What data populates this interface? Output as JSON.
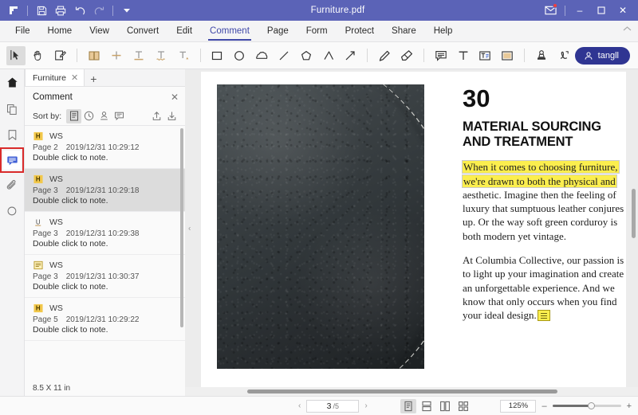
{
  "titlebar": {
    "document_title": "Furniture.pdf",
    "logo_icon": "app-logo-icon",
    "save_icon": "save-icon",
    "print_icon": "print-icon",
    "undo_icon": "undo-icon",
    "redo_icon": "redo-icon",
    "customize_icon": "chevron-down-icon",
    "mail_icon": "mail-icon",
    "minimize_label": "–",
    "maximize_label": "☐",
    "close_label": "✕",
    "accent_color": "#5b63b7",
    "notification_color": "#f03e3e"
  },
  "menubar": {
    "items": [
      {
        "label": "File"
      },
      {
        "label": "Home"
      },
      {
        "label": "View"
      },
      {
        "label": "Convert"
      },
      {
        "label": "Edit"
      },
      {
        "label": "Comment"
      },
      {
        "label": "Page"
      },
      {
        "label": "Form"
      },
      {
        "label": "Protect"
      },
      {
        "label": "Share"
      },
      {
        "label": "Help"
      }
    ],
    "active": "Comment",
    "collapse_icon": "chevron-up-icon",
    "active_color": "#3f48a8"
  },
  "ribbon": {
    "tools": [
      {
        "name": "select-tool",
        "icon": "cursor-select-icon",
        "selected": true
      },
      {
        "name": "hand-tool",
        "icon": "hand-icon",
        "selected": false
      },
      {
        "name": "note-tool",
        "icon": "sticky-note-edit-icon",
        "selected": false
      },
      {
        "name": "highlight-tool",
        "icon": "highlight-icon",
        "selected": false
      },
      {
        "name": "strikethrough-tool",
        "icon": "strikethrough-icon",
        "selected": false
      },
      {
        "name": "underline-tool",
        "icon": "underline-icon",
        "selected": false
      },
      {
        "name": "squiggly-tool",
        "icon": "squiggly-underline-icon",
        "selected": false
      },
      {
        "name": "caret-tool",
        "icon": "caret-insert-icon",
        "selected": false
      },
      {
        "name": "rectangle-tool",
        "icon": "rectangle-icon",
        "selected": false
      },
      {
        "name": "ellipse-tool",
        "icon": "ellipse-icon",
        "selected": false
      },
      {
        "name": "cloud-tool",
        "icon": "cloud-shape-icon",
        "selected": false
      },
      {
        "name": "line-tool",
        "icon": "line-icon",
        "selected": false
      },
      {
        "name": "polygon-tool",
        "icon": "pentagon-icon",
        "selected": false
      },
      {
        "name": "polyline-tool",
        "icon": "polyline-icon",
        "selected": false
      },
      {
        "name": "arrow-tool",
        "icon": "arrow-icon",
        "selected": false
      },
      {
        "name": "pencil-tool",
        "icon": "pencil-icon",
        "selected": false
      },
      {
        "name": "eraser-tool",
        "icon": "eraser-icon",
        "selected": false
      },
      {
        "name": "callout-tool",
        "icon": "callout-icon",
        "selected": false
      },
      {
        "name": "text-tool",
        "icon": "text-t-icon",
        "selected": false
      },
      {
        "name": "textbox-tool",
        "icon": "text-box-icon",
        "selected": false
      },
      {
        "name": "area-highlight-tool",
        "icon": "area-highlight-icon",
        "selected": false
      },
      {
        "name": "stamp-tool",
        "icon": "stamp-icon",
        "selected": false
      },
      {
        "name": "signature-tool",
        "icon": "signature-icon",
        "selected": false
      }
    ],
    "user": {
      "label": "tangll",
      "icon": "user-avatar-icon",
      "color": "#2f3592"
    }
  },
  "rail": {
    "items": [
      {
        "name": "home",
        "icon": "home-icon",
        "selected": false
      },
      {
        "name": "thumbnails",
        "icon": "pages-thumbnail-icon",
        "selected": false
      },
      {
        "name": "bookmarks",
        "icon": "bookmark-icon",
        "selected": false
      },
      {
        "name": "comments",
        "icon": "comment-panel-icon",
        "selected": true
      },
      {
        "name": "attachments",
        "icon": "paperclip-icon",
        "selected": false
      },
      {
        "name": "search",
        "icon": "search-icon",
        "selected": false
      }
    ],
    "highlight_color": "#d92b2b"
  },
  "tabstrip": {
    "tab_label": "Furniture",
    "close_icon": "close-icon",
    "new_tab_icon": "plus-icon"
  },
  "comment_panel": {
    "title": "Comment",
    "close_icon": "close-icon",
    "sort_label": "Sort by:",
    "sort_options": [
      {
        "name": "sort-by-page",
        "icon": "page-icon",
        "selected": true
      },
      {
        "name": "sort-by-time",
        "icon": "clock-icon",
        "selected": false
      },
      {
        "name": "sort-by-author",
        "icon": "person-icon",
        "selected": false
      },
      {
        "name": "sort-by-type",
        "icon": "comment-type-icon",
        "selected": false
      }
    ],
    "import_icon": "import-comments-icon",
    "export_icon": "export-comments-icon",
    "comments": [
      {
        "type_icon": "highlight-mark-icon",
        "type_letter": "H",
        "author": "WS",
        "page": "Page 2",
        "timestamp": "2019/12/31 10:29:12",
        "text": "Double click to note.",
        "selected": false
      },
      {
        "type_icon": "highlight-mark-icon",
        "type_letter": "H",
        "author": "WS",
        "page": "Page 3",
        "timestamp": "2019/12/31 10:29:18",
        "text": "Double click to note.",
        "selected": true
      },
      {
        "type_icon": "underline-mark-icon",
        "type_letter": "U",
        "author": "WS",
        "page": "Page 3",
        "timestamp": "2019/12/31 10:29:38",
        "text": "Double click to note.",
        "selected": false
      },
      {
        "type_icon": "sticky-note-mark-icon",
        "type_letter": "",
        "author": "WS",
        "page": "Page 3",
        "timestamp": "2019/12/31 10:30:37",
        "text": "Double click to note.",
        "selected": false
      },
      {
        "type_icon": "highlight-mark-icon",
        "type_letter": "H",
        "author": "WS",
        "page": "Page 5",
        "timestamp": "2019/12/31 10:29:22",
        "text": "Double click to note.",
        "selected": false
      }
    ],
    "page_size": "8.5 X 11 in"
  },
  "document": {
    "chapter_number": "30",
    "heading_line1": "MATERIAL SOURCING",
    "heading_line2": "AND TREATMENT",
    "highlighted_line1": "When it comes to choosing furniture,",
    "highlighted_line2": "we're drawn to both the physical and",
    "paragraph1_rest": "aesthetic. Imagine then the feeling of luxury that sumptuous leather conjures up. Or the way soft green corduroy is both modern yet vintage.",
    "paragraph2": "At Columbia Collective, our passion is to light up your imagination and create an unforgettable experience. And we know that only occurs when you find your ideal design.",
    "note_annotation_icon": "sticky-note-annotation-icon",
    "highlight_color": "#fbee4e",
    "photo_alt": "close-up photograph of dark grey stitched leather upholstery",
    "prev_page_icon": "chevron-left-icon",
    "next_page_icon": "chevron-right-icon"
  },
  "status": {
    "prev_icon": "chevron-left-icon",
    "next_icon": "chevron-right-icon",
    "current_page": "3",
    "total_pages": "/5",
    "view_modes": [
      {
        "name": "single-page-view",
        "icon": "single-page-icon",
        "selected": true
      },
      {
        "name": "continuous-scroll-view",
        "icon": "continuous-page-icon",
        "selected": false
      },
      {
        "name": "two-page-view",
        "icon": "two-page-icon",
        "selected": false
      },
      {
        "name": "thumbnail-grid-view",
        "icon": "grid-page-icon",
        "selected": false
      }
    ],
    "zoom_level": "125%",
    "zoom_out_label": "–",
    "zoom_in_label": "+"
  }
}
